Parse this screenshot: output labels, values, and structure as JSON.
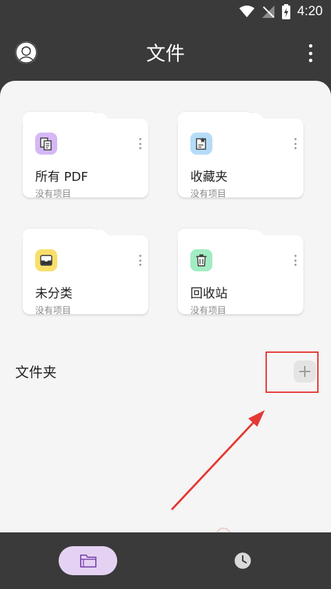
{
  "status_bar": {
    "time": "4:20"
  },
  "app_bar": {
    "title": "文件",
    "avatar_icon": "person-avatar-icon",
    "menu_icon": "more-vertical-icon"
  },
  "cards": [
    {
      "name": "所有 PDF",
      "subtitle": "没有项目",
      "icon": "pdf-files-icon",
      "icon_bg": "#d5b8f5"
    },
    {
      "name": "收藏夹",
      "subtitle": "没有项目",
      "icon": "starred-document-icon",
      "icon_bg": "#b5dcf7"
    },
    {
      "name": "未分类",
      "subtitle": "没有项目",
      "icon": "inbox-tray-icon",
      "icon_bg": "#f8df6b"
    },
    {
      "name": "回收站",
      "subtitle": "没有项目",
      "icon": "trash-icon",
      "icon_bg": "#a2ecc3"
    }
  ],
  "folders_section": {
    "label": "文件夹",
    "add_icon": "plus-icon"
  },
  "bottom_nav": {
    "items": [
      {
        "icon": "folder-icon",
        "active": true,
        "active_bg": "#e5d2f3"
      },
      {
        "icon": "clock-icon",
        "active": false
      }
    ]
  },
  "colors": {
    "background": "#3a3a3a",
    "sheet": "#f5f5f5",
    "card": "#ffffff",
    "annotation": "#e53935",
    "accent": "#7b4bb0"
  }
}
